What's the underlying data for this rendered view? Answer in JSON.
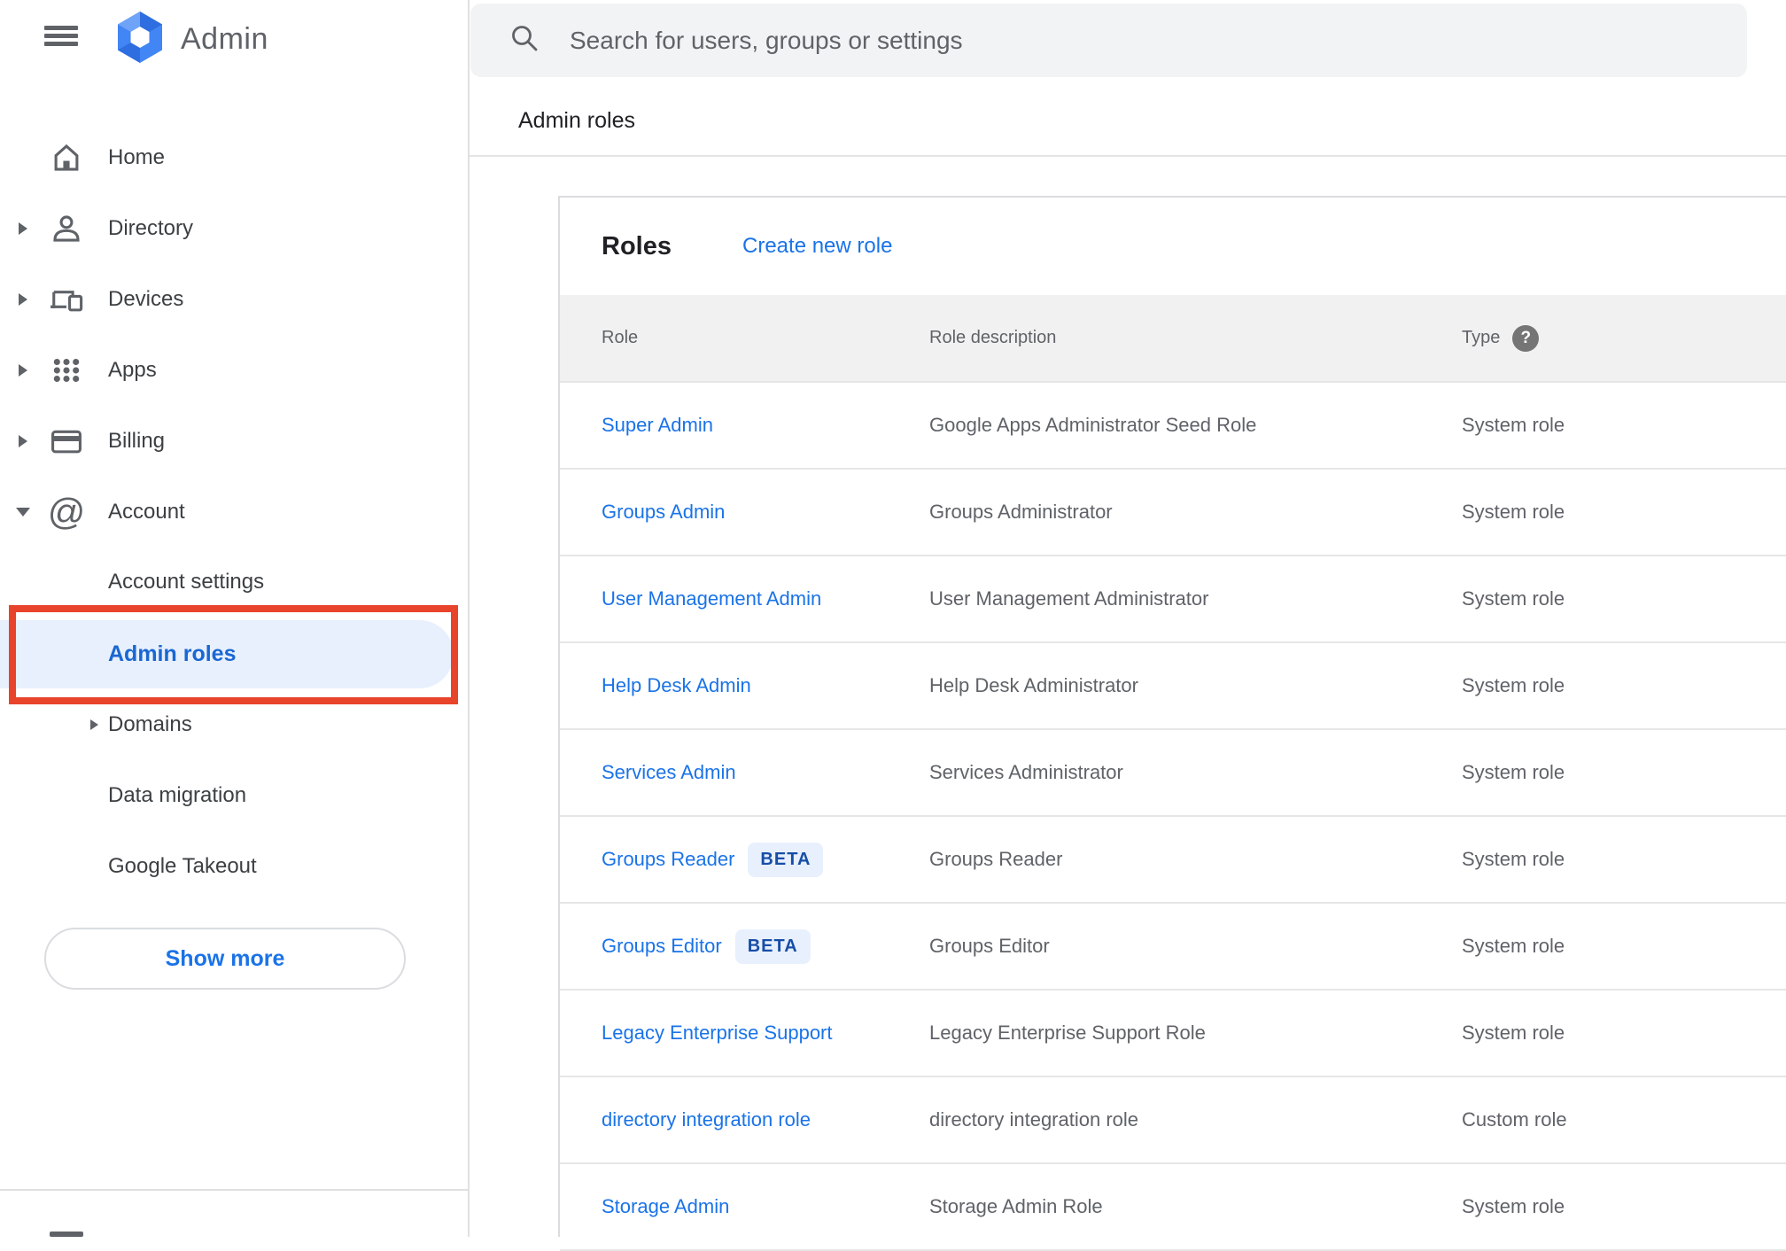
{
  "app": {
    "logo_text": "Admin"
  },
  "search": {
    "placeholder": "Search for users, groups or settings"
  },
  "breadcrumb": {
    "label": "Admin roles"
  },
  "sidebar": {
    "items": [
      {
        "label": "Home",
        "icon": "home-icon",
        "expandable": false
      },
      {
        "label": "Directory",
        "icon": "person-icon",
        "expandable": true
      },
      {
        "label": "Devices",
        "icon": "devices-icon",
        "expandable": true
      },
      {
        "label": "Apps",
        "icon": "apps-grid-icon",
        "expandable": true
      },
      {
        "label": "Billing",
        "icon": "credit-card-icon",
        "expandable": true
      },
      {
        "label": "Account",
        "icon": "at-icon",
        "expanded": true
      }
    ],
    "account_children": [
      {
        "label": "Account settings",
        "selected": false
      },
      {
        "label": "Admin roles",
        "selected": true
      },
      {
        "label": "Domains",
        "expandable": true
      },
      {
        "label": "Data migration"
      },
      {
        "label": "Google Takeout"
      }
    ],
    "show_more_label": "Show more"
  },
  "roles_panel": {
    "title": "Roles",
    "create_link": "Create new role",
    "columns": [
      "Role",
      "Role description",
      "Type"
    ],
    "rows": [
      {
        "role": "Super Admin",
        "beta": false,
        "description": "Google Apps Administrator Seed Role",
        "type": "System role"
      },
      {
        "role": "Groups Admin",
        "beta": false,
        "description": "Groups Administrator",
        "type": "System role"
      },
      {
        "role": "User Management Admin",
        "beta": false,
        "description": "User Management Administrator",
        "type": "System role"
      },
      {
        "role": "Help Desk Admin",
        "beta": false,
        "description": "Help Desk Administrator",
        "type": "System role"
      },
      {
        "role": "Services Admin",
        "beta": false,
        "description": "Services Administrator",
        "type": "System role"
      },
      {
        "role": "Groups Reader",
        "beta": true,
        "beta_label": "BETA",
        "description": "Groups Reader",
        "type": "System role"
      },
      {
        "role": "Groups Editor",
        "beta": true,
        "beta_label": "BETA",
        "description": "Groups Editor",
        "type": "System role"
      },
      {
        "role": "Legacy Enterprise Support",
        "beta": false,
        "description": "Legacy Enterprise Support Role",
        "type": "System role"
      },
      {
        "role": "directory integration role",
        "beta": false,
        "description": "directory integration role",
        "type": "Custom role"
      },
      {
        "role": "Storage Admin",
        "beta": false,
        "description": "Storage Admin Role",
        "type": "System role"
      }
    ]
  },
  "icons": {
    "menu_icon": "hamburger",
    "logo_icon": "blue-hexagon",
    "search_icon": "magnifier",
    "at_glyph": "@",
    "help_glyph": "?"
  },
  "colors": {
    "link_blue": "#1a73e8",
    "selected_blue": "#1967d2",
    "badge_text_blue": "#174ea6",
    "badge_bg": "#e8f0fe",
    "selected_pill_bg": "#e8f0fe",
    "annotation_red": "#e8442b",
    "text_dark": "#202124",
    "text_gray": "#5f6368",
    "header_row_bg": "#f1f1f1",
    "search_bg": "#f1f3f4"
  }
}
